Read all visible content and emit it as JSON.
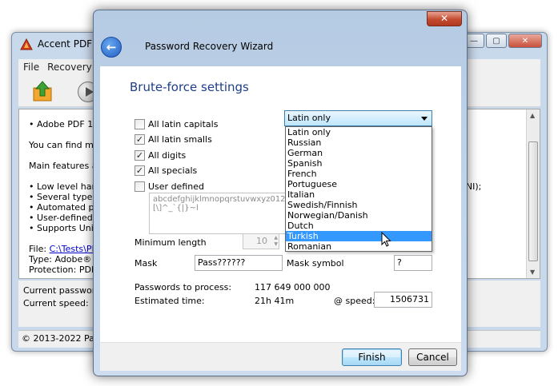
{
  "main_window": {
    "title": "Accent PDF P",
    "menu": [
      "File",
      "Recovery"
    ],
    "content_lines": [
      "• Adobe PDF 1.2",
      "You can find mor",
      "Main features ar",
      "• Low level hand",
      "• Several types c",
      "• Automated pas",
      "• User-defined s",
      "• Supports Unico"
    ],
    "content_right_text": "ES-NI);",
    "file_label": "File:",
    "file_link": "C:\\Tests\\PDF",
    "type_line": "Type: Adobe® PDF",
    "protection_line": "Protection: PDF /F",
    "status_current_password": "Current password",
    "status_current_speed": "Current speed:",
    "footer": "© 2013-2022 Passw"
  },
  "dialog": {
    "title": "Password Recovery Wizard",
    "heading": "Brute-force settings",
    "checkboxes": [
      {
        "label": "All latin capitals",
        "checked": false
      },
      {
        "label": "All latin smalls",
        "checked": true
      },
      {
        "label": "All digits",
        "checked": true
      },
      {
        "label": "All specials",
        "checked": true
      },
      {
        "label": "User defined",
        "checked": false
      }
    ],
    "charset_line1": "abcdefghijklmnopqrstuvwxyz01234",
    "charset_line2": "[\\]^_`{|}~l",
    "language": {
      "selected": "Latin only",
      "options": [
        "Latin only",
        "Russian",
        "German",
        "Spanish",
        "French",
        "Portuguese",
        "Italian",
        "Swedish/Finnish",
        "Norwegian/Danish",
        "Dutch",
        "Turkish",
        "Romanian"
      ],
      "highlighted": "Turkish"
    },
    "min_length_label": "Minimum length",
    "min_length_value": "10",
    "mask_label": "Mask",
    "mask_value": "Pass??????",
    "mask_symbol_label": "Mask symbol",
    "mask_symbol_value": "?",
    "passwords_label": "Passwords to process:",
    "passwords_value": "117 649 000 000",
    "estimated_label": "Estimated time:",
    "estimated_value": "21h 41m",
    "speed_label": "@ speed:",
    "speed_value": "1506731",
    "finish_label": "Finish",
    "cancel_label": "Cancel"
  },
  "icons": {
    "back": "back-arrow-icon",
    "close": "close-icon",
    "app": "pdf-app-icon",
    "cursor": "mouse-pointer-icon"
  },
  "colors": {
    "heading": "#1e3f8a",
    "highlight": "#3399ff",
    "close_button": "#c34a2f"
  }
}
